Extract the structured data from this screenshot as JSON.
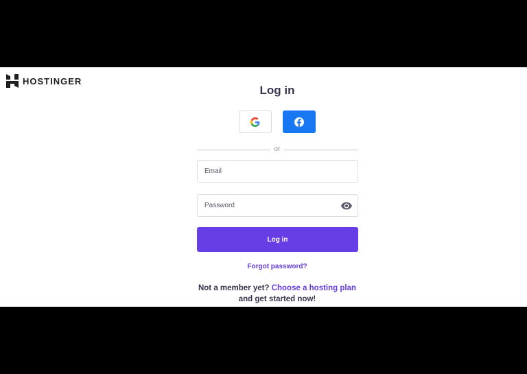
{
  "brand": {
    "name": "HOSTINGER"
  },
  "login": {
    "title": "Log in",
    "divider_text": "or",
    "email_placeholder": "Email",
    "password_placeholder": "Password",
    "submit_label": "Log in",
    "forgot_label": "Forgot password?"
  },
  "signup": {
    "prompt": "Not a member yet?",
    "link": "Choose a hosting plan",
    "suffix": "and get started now!"
  },
  "social": {
    "google_icon": "google-logo",
    "facebook_icon": "facebook-logo"
  },
  "colors": {
    "accent": "#673de6",
    "facebook": "#1877f2",
    "text": "#36344d"
  }
}
